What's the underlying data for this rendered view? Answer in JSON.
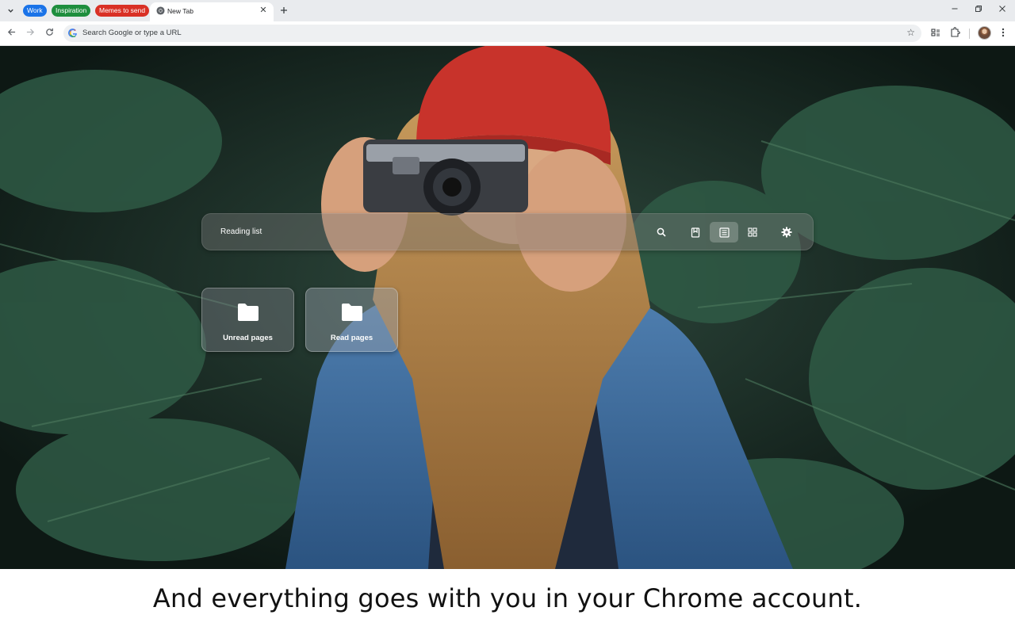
{
  "tab_strip": {
    "groups": [
      {
        "label": "Work",
        "color": "#1a73e8"
      },
      {
        "label": "Inspiration",
        "color": "#1e8e3e"
      },
      {
        "label": "Memes to send",
        "color": "#d93025"
      }
    ],
    "active_tab": {
      "title": "New Tab",
      "icon": "chrome-icon"
    },
    "new_tab_icon": "plus-icon",
    "window_controls": [
      "minimize-icon",
      "restore-icon",
      "close-icon"
    ]
  },
  "toolbar": {
    "omnibox": {
      "placeholder": "Search Google or type a URL",
      "icon": "google-g-icon"
    },
    "icons": [
      "back-icon",
      "forward-icon",
      "reload-icon",
      "bookmark-star-icon",
      "reading-list-icon",
      "extensions-icon",
      "avatar",
      "more-menu-icon"
    ]
  },
  "ntp": {
    "reading_list_bar": {
      "title": "Reading list",
      "icons": [
        "search-icon",
        "bookmark-icon",
        "list-view-icon",
        "grid-view-icon",
        "settings-gear-icon"
      ],
      "selected_view": "list"
    },
    "folders": [
      {
        "label": "Unread pages",
        "icon": "folder-icon"
      },
      {
        "label": "Read pages",
        "icon": "folder-icon"
      }
    ]
  },
  "caption": "And everything goes with you in your Chrome account."
}
